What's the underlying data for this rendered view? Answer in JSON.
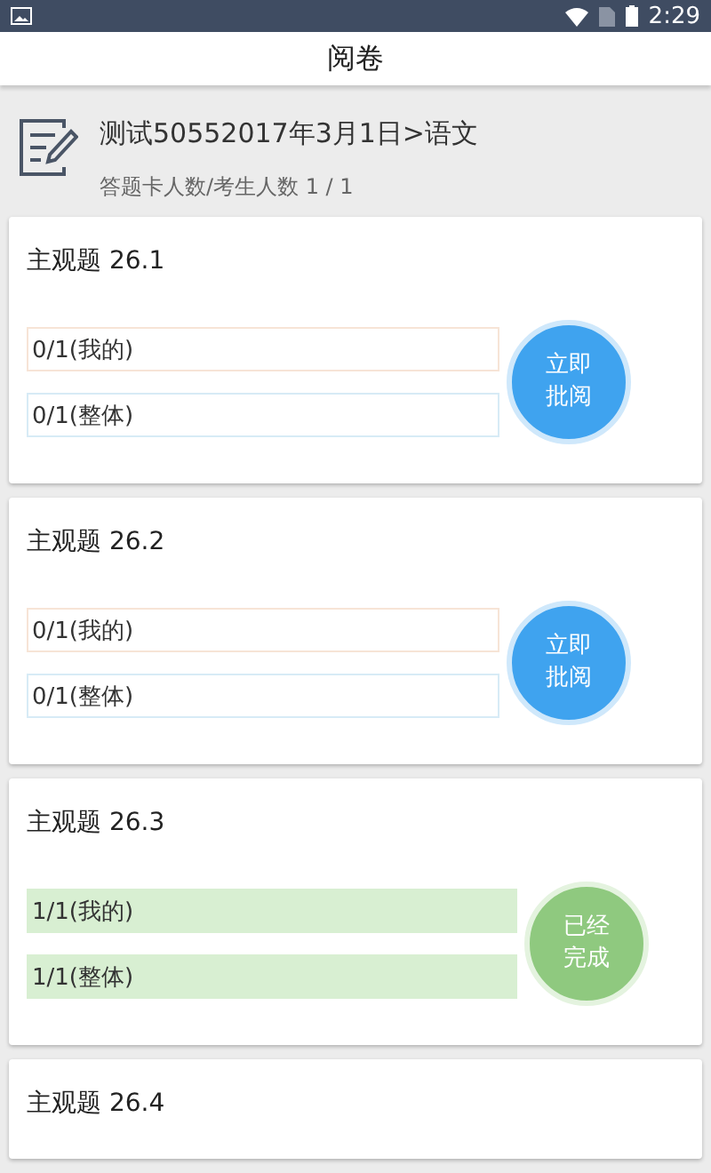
{
  "status_bar": {
    "time": "2:29"
  },
  "header": {
    "title": "阅卷"
  },
  "exam": {
    "title": "测试50552017年3月1日>语文",
    "counts": "答题卡人数/考生人数 1 / 1"
  },
  "questions": [
    {
      "title": "主观题  26.1",
      "mine": "0/1(我的)",
      "overall": "0/1(整体)",
      "done": false,
      "action": "立即批阅"
    },
    {
      "title": "主观题  26.2",
      "mine": "0/1(我的)",
      "overall": "0/1(整体)",
      "done": false,
      "action": "立即批阅"
    },
    {
      "title": "主观题  26.3",
      "mine": "1/1(我的)",
      "overall": "1/1(整体)",
      "done": true,
      "action": "已经完成"
    },
    {
      "title": "主观题  26.4"
    }
  ]
}
